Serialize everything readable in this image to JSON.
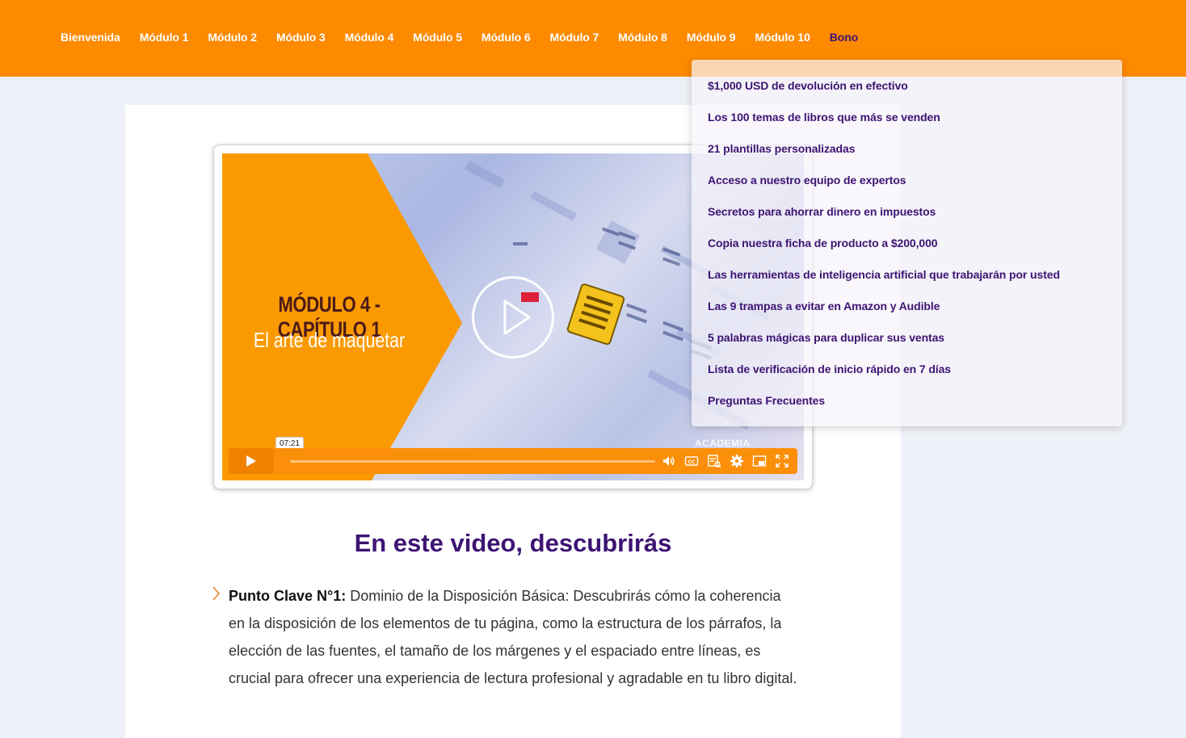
{
  "nav": {
    "items": [
      "Bienvenida",
      "Módulo 1",
      "Módulo 2",
      "Módulo 3",
      "Módulo 4",
      "Módulo 5",
      "Módulo 6",
      "Módulo 7",
      "Módulo 8",
      "Módulo 9",
      "Módulo 10",
      "Bono"
    ],
    "active": "Bono"
  },
  "colors": {
    "brand_orange": "#fe8a00",
    "accent_purple": "#3d1373",
    "background": "#eef1f7"
  },
  "dropdown": {
    "items": [
      "$1,000 USD de devolución en efectivo",
      "Los 100 temas de libros que más se venden",
      "21 plantillas personalizadas",
      "Acceso a nuestro equipo de expertos",
      "Secretos para ahorrar dinero en impuestos",
      "Copia nuestra ficha de producto a $200,000",
      "Las herramientas de inteligencia artificial que trabajarán por usted",
      "Las 9 trampas a evitar en Amazon y Audible",
      "5 palabras mágicas para duplicar sus ventas",
      "Lista de verificación de inicio rápido en 7 días",
      "Preguntas Frecuentes"
    ]
  },
  "video": {
    "thumbnail_title": "MÓDULO 4 - CAPÍTULO 1",
    "thumbnail_subtitle": "El arte de maquetar",
    "thumbnail_brand": "ACADEMIA EDITORIAL",
    "time_tooltip": "07:21",
    "progress_fraction": 0,
    "controls": [
      "play-icon",
      "volume-icon",
      "captions-icon",
      "chapters-icon",
      "settings-icon",
      "pip-icon",
      "fullscreen-icon"
    ]
  },
  "section": {
    "title": "En este video, descubrirás"
  },
  "point": {
    "label": "Punto Clave N°1:",
    "text": " Dominio de la Disposición Básica: Descubrirás cómo la coherencia en la disposición de los elementos de tu página, como la estructura de los párrafos, la elección de las fuentes, el tamaño de los márgenes y el espaciado entre líneas, es crucial para ofrecer una experiencia de lectura profesional y agradable en tu libro digital."
  }
}
